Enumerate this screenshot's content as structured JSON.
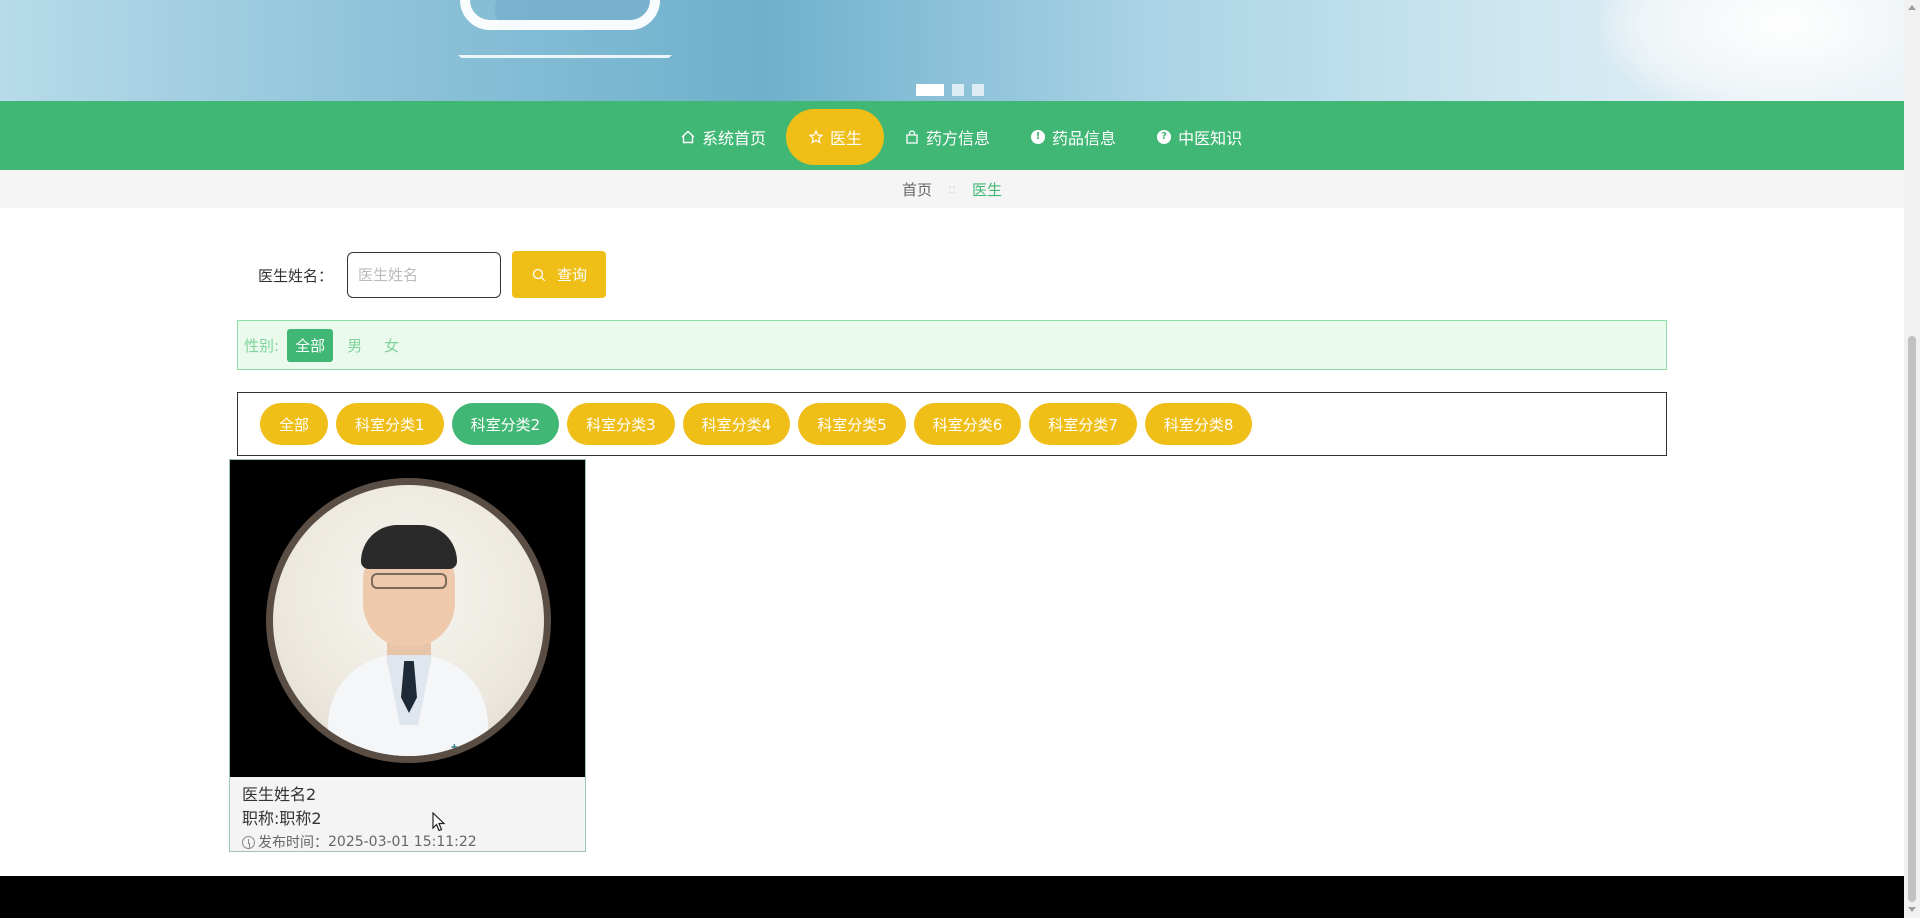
{
  "banner": {
    "slides": 3,
    "active_slide": 1
  },
  "nav": {
    "items": [
      {
        "label": "系统首页",
        "icon": "home-icon",
        "glyph": "⌂"
      },
      {
        "label": "医生",
        "icon": "star-icon",
        "glyph": "☆"
      },
      {
        "label": "药方信息",
        "icon": "bag-icon",
        "glyph": "⛉"
      },
      {
        "label": "药品信息",
        "icon": "exclamation-circle-icon",
        "glyph": "!"
      },
      {
        "label": "中医知识",
        "icon": "question-circle-icon",
        "glyph": "?"
      }
    ],
    "active_index": 1
  },
  "breadcrumb": {
    "home": "首页",
    "separator": "::",
    "current": "医生"
  },
  "search": {
    "label": "医生姓名：",
    "placeholder": "医生姓名",
    "value": "",
    "button_label": "查询",
    "button_icon": "search-icon"
  },
  "gender_filter": {
    "label": "性别:",
    "options": [
      "全部",
      "男",
      "女"
    ],
    "active_index": 0
  },
  "category_filter": {
    "options": [
      "全部",
      "科室分类1",
      "科室分类2",
      "科室分类3",
      "科室分类4",
      "科室分类5",
      "科室分类6",
      "科室分类7",
      "科室分类8"
    ],
    "active_index": 2
  },
  "doctors": [
    {
      "name": "医生姓名2",
      "title": "职称:职称2",
      "time_label": "发布时间：",
      "time": "2025-03-01 15:11:22"
    }
  ],
  "colors": {
    "green": "#41b775",
    "yellow": "#efbe17",
    "footer": "#000000"
  }
}
